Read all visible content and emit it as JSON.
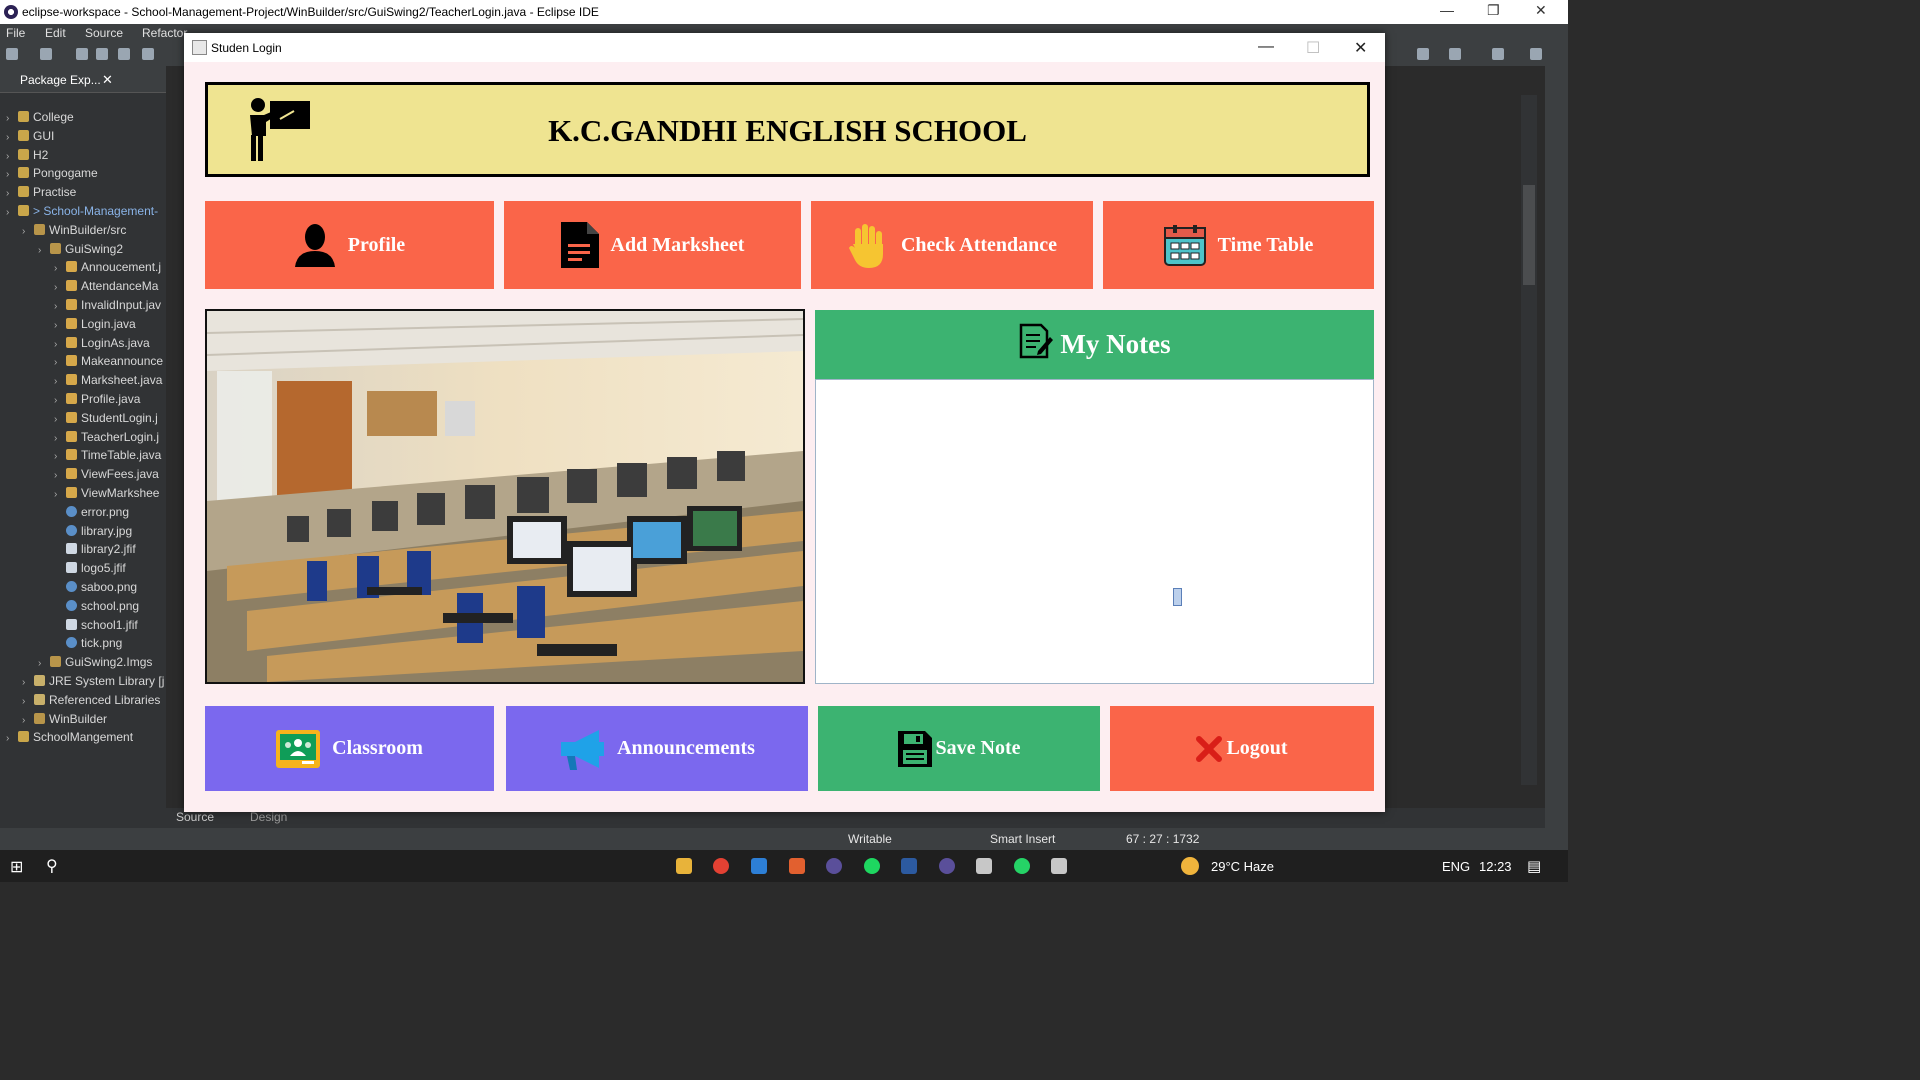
{
  "ide": {
    "title": "eclipse-workspace - School-Management-Project/WinBuilder/src/GuiSwing2/TeacherLogin.java - Eclipse IDE",
    "menu": [
      "File",
      "Edit",
      "Source",
      "Refactor"
    ],
    "package_explorer_title": "Package Exp...",
    "tree": [
      {
        "label": "College",
        "depth": 0,
        "icon": "project"
      },
      {
        "label": "GUI",
        "depth": 0,
        "icon": "project"
      },
      {
        "label": "H2",
        "depth": 0,
        "icon": "project"
      },
      {
        "label": "Pongogame",
        "depth": 0,
        "icon": "project"
      },
      {
        "label": "Practise",
        "depth": 0,
        "icon": "project"
      },
      {
        "label": "> School-Management-",
        "depth": 0,
        "icon": "project"
      },
      {
        "label": "WinBuilder/src",
        "depth": 1,
        "icon": "package"
      },
      {
        "label": "GuiSwing2",
        "depth": 2,
        "icon": "package"
      },
      {
        "label": "Annoucement.j",
        "depth": 3,
        "icon": "java"
      },
      {
        "label": "AttendanceMa",
        "depth": 3,
        "icon": "java"
      },
      {
        "label": "InvalidInput.jav",
        "depth": 3,
        "icon": "java"
      },
      {
        "label": "Login.java",
        "depth": 3,
        "icon": "java"
      },
      {
        "label": "LoginAs.java",
        "depth": 3,
        "icon": "java"
      },
      {
        "label": "Makeannounce",
        "depth": 3,
        "icon": "java"
      },
      {
        "label": "Marksheet.java",
        "depth": 3,
        "icon": "java"
      },
      {
        "label": "Profile.java",
        "depth": 3,
        "icon": "java"
      },
      {
        "label": "StudentLogin.j",
        "depth": 3,
        "icon": "java"
      },
      {
        "label": "TeacherLogin.j",
        "depth": 3,
        "icon": "java"
      },
      {
        "label": "TimeTable.java",
        "depth": 3,
        "icon": "java"
      },
      {
        "label": "ViewFees.java",
        "depth": 3,
        "icon": "java"
      },
      {
        "label": "ViewMarkshee",
        "depth": 3,
        "icon": "java"
      },
      {
        "label": "error.png",
        "depth": 3,
        "icon": "image"
      },
      {
        "label": "library.jpg",
        "depth": 3,
        "icon": "image"
      },
      {
        "label": "library2.jfif",
        "depth": 3,
        "icon": "file"
      },
      {
        "label": "logo5.jfif",
        "depth": 3,
        "icon": "file"
      },
      {
        "label": "saboo.png",
        "depth": 3,
        "icon": "image"
      },
      {
        "label": "school.png",
        "depth": 3,
        "icon": "image"
      },
      {
        "label": "school1.jfif",
        "depth": 3,
        "icon": "file"
      },
      {
        "label": "tick.png",
        "depth": 3,
        "icon": "image"
      },
      {
        "label": "GuiSwing2.Imgs",
        "depth": 2,
        "icon": "package"
      },
      {
        "label": "JRE System Library [j",
        "depth": 1,
        "icon": "library"
      },
      {
        "label": "Referenced Libraries",
        "depth": 1,
        "icon": "library"
      },
      {
        "label": "WinBuilder",
        "depth": 1,
        "icon": "package"
      },
      {
        "label": "SchoolMangement",
        "depth": 0,
        "icon": "project"
      }
    ],
    "editor_tabs": [
      "Source",
      "Design"
    ],
    "status": {
      "writable": "Writable",
      "insert_mode": "Smart Insert",
      "position": "67 : 27 : 1732"
    }
  },
  "taskbar": {
    "weather": "29°C Haze",
    "language": "ENG",
    "time": "12:23"
  },
  "dialog": {
    "title": "Studen Login",
    "school_name": "K.C.GANDHI ENGLISH SCHOOL",
    "top_buttons": [
      {
        "label": "Profile",
        "icon": "person-icon"
      },
      {
        "label": "Add Marksheet",
        "icon": "document-icon"
      },
      {
        "label": "Check Attendance",
        "icon": "hand-icon"
      },
      {
        "label": "Time Table",
        "icon": "calendar-icon"
      }
    ],
    "notes_title": "My Notes",
    "notes_text": "",
    "bottom_buttons": [
      {
        "label": "Classroom",
        "icon": "classroom-icon"
      },
      {
        "label": "Announcements",
        "icon": "megaphone-icon"
      },
      {
        "label": "Save Note",
        "icon": "floppy-icon"
      },
      {
        "label": "Logout",
        "icon": "x-icon"
      }
    ],
    "colors": {
      "background": "#fdeef1",
      "banner": "#efe491",
      "orange": "#fa6549",
      "purple": "#7b68ee",
      "green": "#3cb371"
    }
  }
}
